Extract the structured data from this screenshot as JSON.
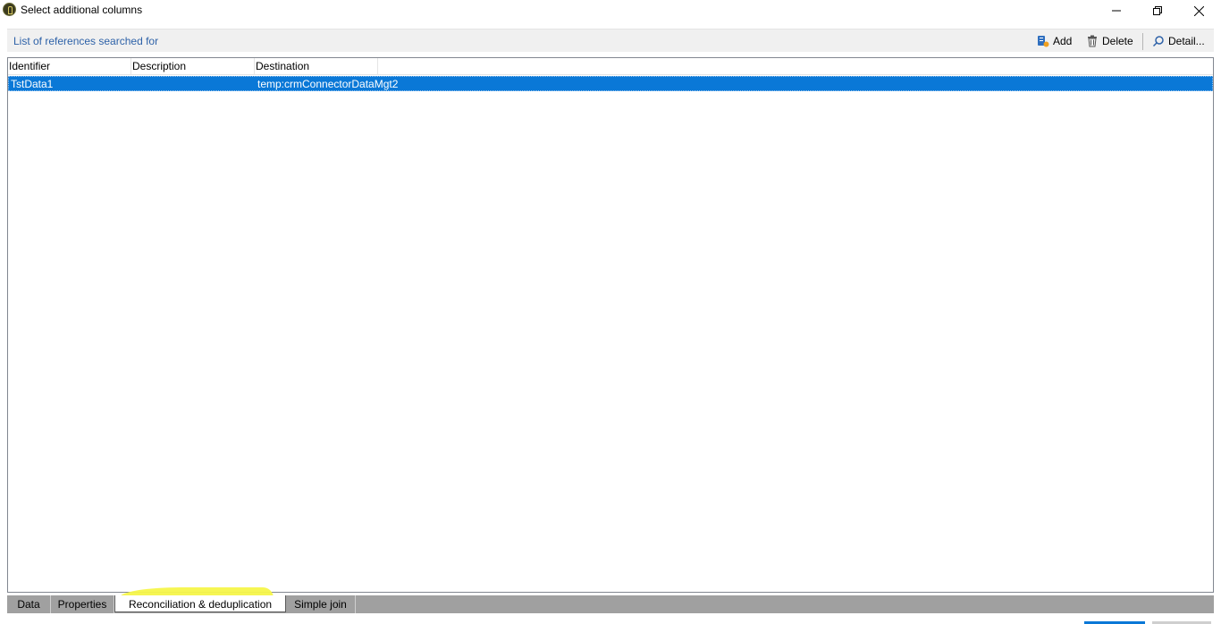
{
  "window": {
    "title": "Select additional columns",
    "controls": {
      "minimize": "minimize-icon",
      "restore": "restore-icon",
      "close": "close-icon"
    }
  },
  "header": {
    "title": "List of references searched for",
    "buttons": {
      "add_label": "Add",
      "delete_label": "Delete",
      "detail_label": "Detail..."
    }
  },
  "list": {
    "columns": [
      "Identifier",
      "Description",
      "Destination"
    ],
    "rows": [
      {
        "identifier": "TstData1",
        "description": "",
        "destination": "temp:crmConnectorDataMgt2",
        "selected": true
      }
    ]
  },
  "tabs": [
    {
      "label": "Data",
      "active": false
    },
    {
      "label": "Properties",
      "active": false
    },
    {
      "label": "Reconciliation & deduplication",
      "active": true
    },
    {
      "label": "Simple join",
      "active": false
    }
  ],
  "colors": {
    "accent": "#0a78d7",
    "header_text": "#2e62a8",
    "tabbar": "#a0a0a0",
    "highlight": "#f6f64a"
  }
}
